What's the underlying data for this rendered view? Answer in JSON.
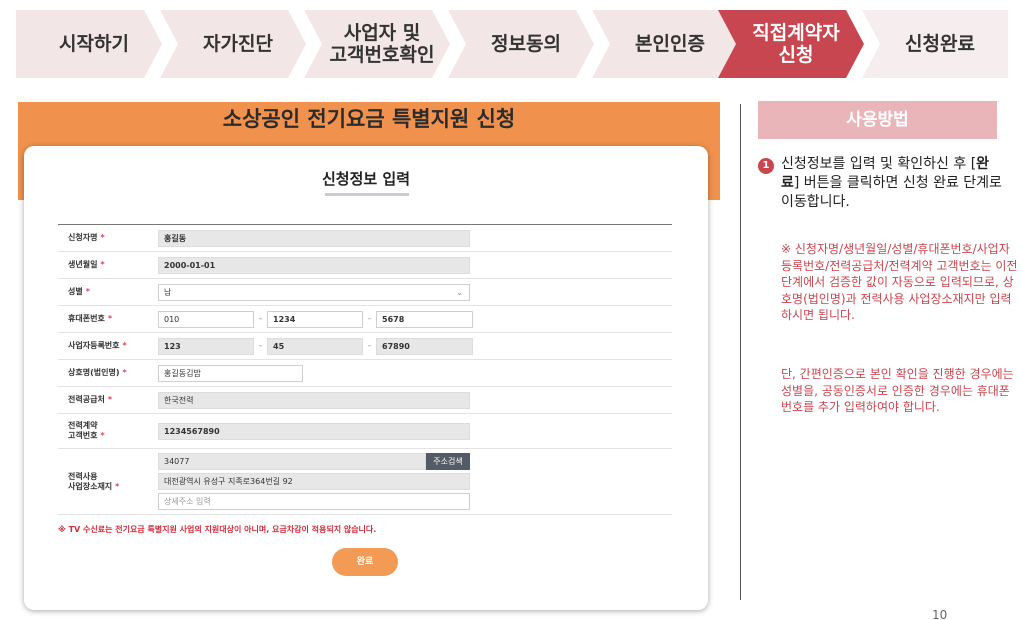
{
  "steps": [
    {
      "label": "시작하기",
      "state": "done"
    },
    {
      "label": "자가진단",
      "state": "done"
    },
    {
      "label": "사업자 및\n고객번호확인",
      "state": "done"
    },
    {
      "label": "정보동의",
      "state": "done"
    },
    {
      "label": "본인인증",
      "state": "done"
    },
    {
      "label": "직접계약자\n신청",
      "state": "active"
    },
    {
      "label": "신청완료",
      "state": "todo"
    }
  ],
  "page": {
    "title": "소상공인 전기요금 특별지원 신청",
    "number": "10"
  },
  "form": {
    "title": "신청정보 입력",
    "required_mark": "*",
    "fields": {
      "applicant_name": {
        "label": "신청자명",
        "value": "홍길동"
      },
      "birthdate": {
        "label": "생년월일",
        "value": "2000-01-01"
      },
      "gender": {
        "label": "성별",
        "value": "남"
      },
      "mobile": {
        "label": "휴대폰번호",
        "parts": [
          "010",
          "1234",
          "5678"
        ]
      },
      "business_no": {
        "label": "사업자등록번호",
        "parts": [
          "123",
          "45",
          "67890"
        ]
      },
      "company_name": {
        "label": "상호명(법인명)",
        "value": "홍길동김밥"
      },
      "power_supplier": {
        "label": "전력공급처",
        "value": "한국전력"
      },
      "contract_no": {
        "label": "전력계약\n고객번호",
        "value": "1234567890"
      },
      "address": {
        "label": "전력사용\n사업장소재지",
        "zipcode": "34077",
        "search_button": "주소검색",
        "road_address": "대전광역시 유성구 지족로364번길 92",
        "detail_placeholder": "상세주소 입력"
      }
    },
    "notice": "※ TV 수신료는 전기요금 특별지원 사업의 지원대상이 아니며, 요금차감이 적용되지 않습니다.",
    "submit_label": "완료"
  },
  "guide": {
    "header": "사용방법",
    "step_number": "1",
    "text_before": "신청정보를 입력 및 확인하신 후 [",
    "text_bold": "완료",
    "text_after": "] 버튼을 클릭하면 신청 완료 단계로 이동합니다.",
    "note1": "※ 신청자명/생년월일/성별/휴대폰번호/사업자등록번호/전력공급처/전력계약 고객번호는 이전 단계에서 검증한 값이 자동으로 입력되므로, 상호명(법인명)과 전력사용 사업장소재지만 입력하시면 됩니다.",
    "note2": "단, 간편인증으로 본인 확인을 진행한 경우에는 성별을, 공동인증서로 인증한 경우에는 휴대폰번호를 추가 입력하여야 합니다."
  },
  "colors": {
    "active_step": "#c8464f",
    "hero_band": "#f0924e",
    "submit_button": "#f39a55",
    "guide_header": "#eab5b8",
    "required": "#e0405b"
  }
}
